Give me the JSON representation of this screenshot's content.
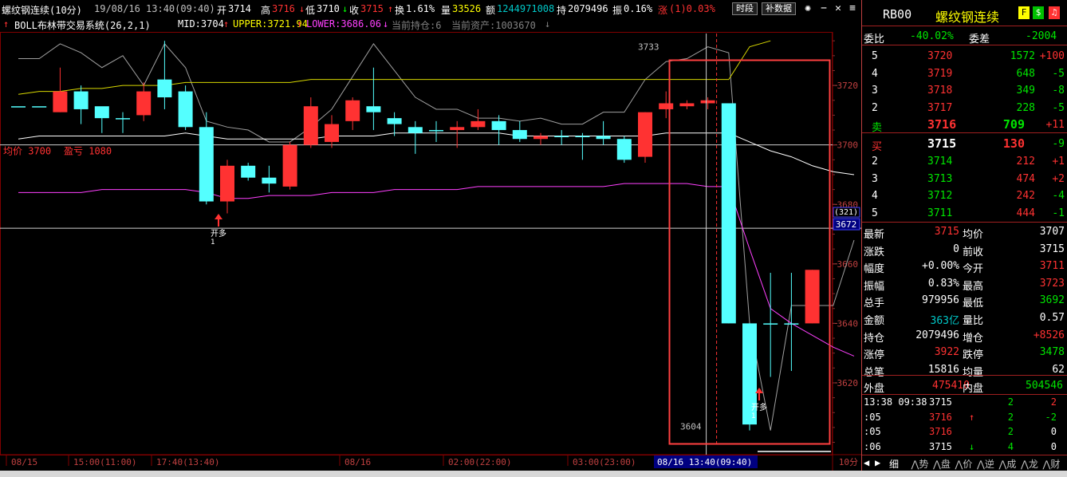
{
  "header": {
    "name": "螺纹钢连续(10分)",
    "datetime": "19/08/16 13:40(09:40)",
    "open_label": "开",
    "open_val": "3714",
    "high_label": "高",
    "high_val": "3716",
    "low_label": "低",
    "low_val": "3710",
    "close_label": "收",
    "close_val": "3715",
    "turnover_label": "换",
    "turnover_val": "1.61%",
    "vol_label": "量",
    "vol_val": "33526",
    "amount_label": "额",
    "amount_val": "1244971008",
    "oi_label": "持",
    "oi_val": "2079496",
    "amp_label": "振",
    "amp_val": "0.16%",
    "chg_label": "涨",
    "chg_val": "(1)0.03%",
    "btn_period": "时段",
    "btn_data": "补数据"
  },
  "indicator": {
    "name": "BOLL布林带交易系统(26,2,1)",
    "mid": "MID:3704",
    "upper": "UPPER:3721.94",
    "lower": "LOWER:3686.06",
    "position": "当前持仓:6",
    "assets": "当前资产:1003670"
  },
  "overlay": {
    "avg_label": "均价",
    "avg_val": "3700",
    "pnl_label": "盈亏",
    "pnl_val": "1080",
    "marker1_text": "开多",
    "marker1_num": "1",
    "marker2_text": "开多",
    "marker2_num": "1",
    "hi_label": "3733",
    "lo_label": "3604"
  },
  "axis": {
    "price_ticks": [
      "3720",
      "3700",
      "3680",
      "3660",
      "3640",
      "3620"
    ],
    "crosshair_price": "3672",
    "crosshair_count": "(321)",
    "time_labels": [
      "08/15",
      "15:00(11:00)",
      "17:40(13:40)",
      "08/16",
      "02:00(22:00)",
      "03:00(23:00)"
    ],
    "cursor_time": "08/16 13:40(09:40)",
    "period": "10分"
  },
  "colors": {
    "up": "#ff3232",
    "down": "#54ffff",
    "mid": "#ffffff",
    "upper": "#d8d800",
    "lower": "#ff40ff",
    "grid": "#800000",
    "highlight": "#ff4040"
  },
  "chart_data": {
    "type": "candlestick",
    "ylim": [
      3598,
      3738
    ],
    "candles": [
      {
        "o": 3713,
        "c": 3713,
        "h": 3713,
        "l": 3713
      },
      {
        "o": 3713,
        "c": 3713,
        "h": 3713,
        "l": 3713
      },
      {
        "o": 3711,
        "c": 3718,
        "h": 3726,
        "l": 3711
      },
      {
        "o": 3718,
        "c": 3712,
        "h": 3720,
        "l": 3707
      },
      {
        "o": 3713,
        "c": 3709,
        "h": 3712,
        "l": 3704
      },
      {
        "o": 3709,
        "c": 3709,
        "h": 3711,
        "l": 3704
      },
      {
        "o": 3710,
        "c": 3718,
        "h": 3721,
        "l": 3708
      },
      {
        "o": 3722,
        "c": 3716,
        "h": 3735,
        "l": 3712
      },
      {
        "o": 3718,
        "c": 3706,
        "h": 3720,
        "l": 3705
      },
      {
        "o": 3706,
        "c": 3681,
        "h": 3711,
        "l": 3680
      },
      {
        "o": 3681,
        "c": 3693,
        "h": 3695,
        "l": 3677
      },
      {
        "o": 3693,
        "c": 3689,
        "h": 3694,
        "l": 3688
      },
      {
        "o": 3689,
        "c": 3687,
        "h": 3693,
        "l": 3684
      },
      {
        "o": 3686,
        "c": 3700,
        "h": 3701,
        "l": 3685
      },
      {
        "o": 3700,
        "c": 3713,
        "h": 3716,
        "l": 3699
      },
      {
        "o": 3701,
        "c": 3707,
        "h": 3710,
        "l": 3699
      },
      {
        "o": 3708,
        "c": 3715,
        "h": 3716,
        "l": 3705
      },
      {
        "o": 3713,
        "c": 3711,
        "h": 3726,
        "l": 3705
      },
      {
        "o": 3709,
        "c": 3707,
        "h": 3711,
        "l": 3703
      },
      {
        "o": 3706,
        "c": 3704,
        "h": 3708,
        "l": 3697
      },
      {
        "o": 3705,
        "c": 3705,
        "h": 3708,
        "l": 3701
      },
      {
        "o": 3705,
        "c": 3706,
        "h": 3708,
        "l": 3699
      },
      {
        "o": 3706,
        "c": 3708,
        "h": 3712,
        "l": 3705
      },
      {
        "o": 3708,
        "c": 3705,
        "h": 3710,
        "l": 3700
      },
      {
        "o": 3705,
        "c": 3702,
        "h": 3708,
        "l": 3701
      },
      {
        "o": 3702,
        "c": 3703,
        "h": 3704,
        "l": 3700
      },
      {
        "o": 3703,
        "c": 3703,
        "h": 3705,
        "l": 3700
      },
      {
        "o": 3703,
        "c": 3703,
        "h": 3704,
        "l": 3695
      },
      {
        "o": 3703,
        "c": 3702,
        "h": 3708,
        "l": 3700
      },
      {
        "o": 3702,
        "c": 3695,
        "h": 3703,
        "l": 3694
      },
      {
        "o": 3696,
        "c": 3711,
        "h": 3711,
        "l": 3694
      },
      {
        "o": 3712,
        "c": 3714,
        "h": 3718,
        "l": 3709
      },
      {
        "o": 3713,
        "c": 3714,
        "h": 3715,
        "l": 3712
      },
      {
        "o": 3714,
        "c": 3715,
        "h": 3716,
        "l": 3712
      },
      {
        "o": 3714,
        "c": 3640,
        "h": 3714,
        "l": 3640
      },
      {
        "o": 3640,
        "c": 3606,
        "h": 3640,
        "l": 3604
      },
      {
        "o": 3640,
        "c": 3640,
        "h": 3657,
        "l": 3622
      },
      {
        "o": 3640,
        "c": 3640,
        "h": 3657,
        "l": 3624
      },
      {
        "o": 3640,
        "c": 3658,
        "h": 3658,
        "l": 3640
      }
    ],
    "mid_line": [
      3702,
      3703,
      3703,
      3703,
      3703,
      3703,
      3703,
      3703,
      3704,
      3703,
      3702,
      3702,
      3702,
      3702,
      3702,
      3703,
      3703,
      3703,
      3704,
      3704,
      3704,
      3704,
      3704,
      3704,
      3703,
      3703,
      3703,
      3703,
      3703,
      3703,
      3703,
      3704,
      3704,
      3704,
      3704,
      3701,
      3698,
      3696,
      3693,
      3691,
      3690
    ],
    "upper_line": [
      3717,
      3718,
      3718,
      3719,
      3719,
      3720,
      3720,
      3720,
      3721,
      3721,
      3721,
      3721,
      3721,
      3721,
      3722,
      3722,
      3722,
      3722,
      3722,
      3722,
      3722,
      3722,
      3722,
      3722,
      3722,
      3722,
      3722,
      3722,
      3722,
      3722,
      3722,
      3722,
      3722,
      3722,
      3722,
      3733,
      3735
    ],
    "lower_line": [
      3684,
      3684,
      3684,
      3684,
      3685,
      3685,
      3685,
      3685,
      3685,
      3684,
      3682,
      3682,
      3683,
      3683,
      3683,
      3684,
      3684,
      3684,
      3685,
      3685,
      3685,
      3685,
      3686,
      3686,
      3686,
      3686,
      3686,
      3686,
      3686,
      3687,
      3687,
      3687,
      3687,
      3686,
      3686,
      3665,
      3645,
      3640,
      3636,
      3632,
      3629
    ],
    "thin_line": [
      3729,
      3729,
      3734,
      3731,
      3726,
      3730,
      3720,
      3734,
      3726,
      3708,
      3706,
      3705,
      3701,
      3701,
      3706,
      3712,
      3723,
      3734,
      3725,
      3716,
      3712,
      3712,
      3709,
      3709,
      3708,
      3709,
      3707,
      3707,
      3711,
      3711,
      3722,
      3728,
      3729,
      3733,
      3731,
      3640,
      3604,
      3646,
      3646,
      3646,
      3668
    ]
  },
  "panel": {
    "code": "RB00",
    "name": "螺纹钢连续",
    "icon_f": "F",
    "icon_dollar": "$",
    "weibi_label": "委比",
    "weibi_val": "-40.02%",
    "weicha_label": "委差",
    "weicha_val": "-2004",
    "asks": [
      {
        "lvl": "5",
        "price": "3720",
        "vol": "1572",
        "chg": "+100"
      },
      {
        "lvl": "4",
        "price": "3719",
        "vol": "648",
        "chg": "-5"
      },
      {
        "lvl": "3",
        "price": "3718",
        "vol": "349",
        "chg": "-8"
      },
      {
        "lvl": "2",
        "price": "3717",
        "vol": "228",
        "chg": "-5"
      },
      {
        "lvl": "卖",
        "price": "3716",
        "vol": "709",
        "chg": "+11"
      }
    ],
    "bids": [
      {
        "lvl": "买",
        "price": "3715",
        "vol": "130",
        "chg": "-9"
      },
      {
        "lvl": "2",
        "price": "3714",
        "vol": "212",
        "chg": "+1"
      },
      {
        "lvl": "3",
        "price": "3713",
        "vol": "474",
        "chg": "+2"
      },
      {
        "lvl": "4",
        "price": "3712",
        "vol": "242",
        "chg": "-4"
      },
      {
        "lvl": "5",
        "price": "3711",
        "vol": "444",
        "chg": "-1"
      }
    ],
    "stats": [
      {
        "l1": "最新",
        "v1": "3715",
        "l2": "均价",
        "v2": "3707"
      },
      {
        "l1": "涨跌",
        "v1": "0",
        "l2": "前收",
        "v2": "3715"
      },
      {
        "l1": "幅度",
        "v1": "+0.00%",
        "l2": "今开",
        "v2": "3711"
      },
      {
        "l1": "振幅",
        "v1": "0.83%",
        "l2": "最高",
        "v2": "3723"
      },
      {
        "l1": "总手",
        "v1": "979956",
        "l2": "最低",
        "v2": "3692"
      },
      {
        "l1": "金额",
        "v1": "363亿",
        "l2": "量比",
        "v2": "0.57"
      },
      {
        "l1": "持仓",
        "v1": "2079496",
        "l2": "增仓",
        "v2": "+8526"
      },
      {
        "l1": "涨停",
        "v1": "3922",
        "l2": "跌停",
        "v2": "3478"
      },
      {
        "l1": "总笔",
        "v1": "15816",
        "l2": "均量",
        "v2": "62"
      }
    ],
    "waipan_label": "外盘",
    "waipan_val": "475410",
    "neipan_label": "内盘",
    "neipan_val": "504546",
    "ticks": [
      {
        "t": "13:38 09:38",
        "p": "3715",
        "arrow": "",
        "v": "2",
        "d": "2"
      },
      {
        "t": ":05",
        "p": "3716",
        "arrow": "↑",
        "v": "2",
        "d": "-2"
      },
      {
        "t": ":05",
        "p": "3716",
        "arrow": "",
        "v": "2",
        "d": "0"
      },
      {
        "t": ":06",
        "p": "3715",
        "arrow": "↓",
        "v": "4",
        "d": "0"
      }
    ],
    "tabs": [
      "细",
      "势",
      "盘",
      "价",
      "逆",
      "成",
      "龙",
      "财"
    ]
  }
}
